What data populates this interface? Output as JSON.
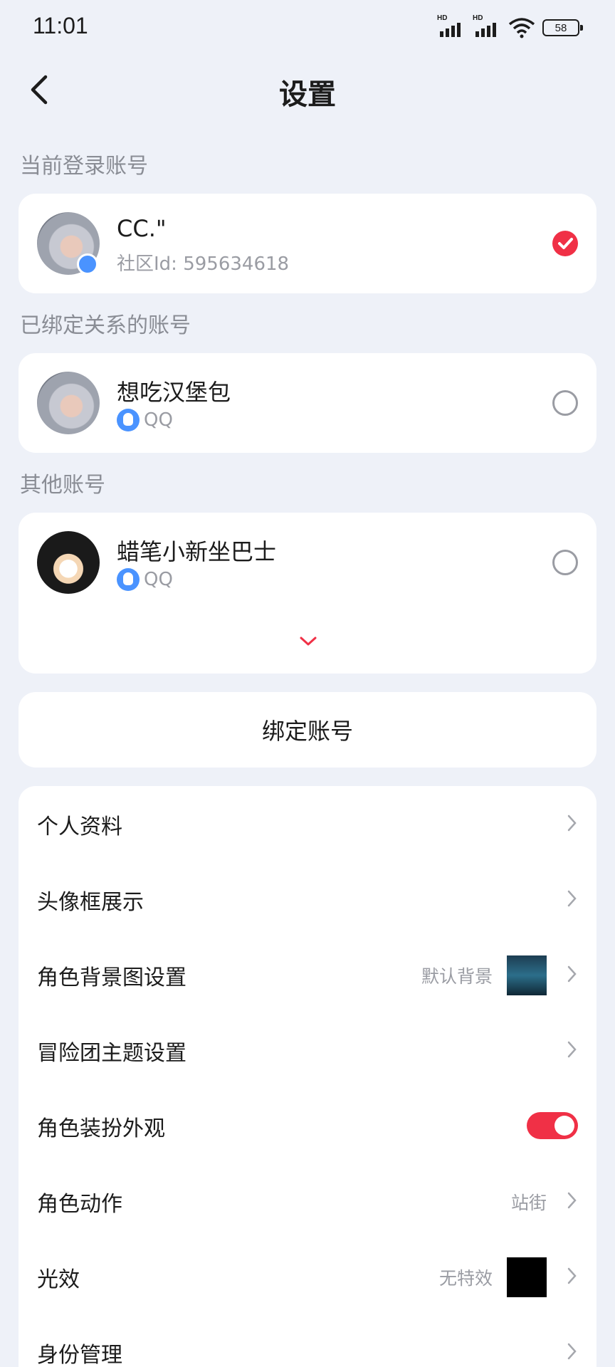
{
  "status_bar": {
    "time": "11:01",
    "hd1": "HD",
    "hd2": "HD",
    "battery": "58"
  },
  "header": {
    "title": "设置"
  },
  "current_account": {
    "section_label": "当前登录账号",
    "name": "CC.\"",
    "community_id": "社区Id: 595634618",
    "selected": true
  },
  "bound_accounts": {
    "section_label": "已绑定关系的账号",
    "items": [
      {
        "name": "想吃汉堡包",
        "platform": "QQ",
        "selected": false
      }
    ]
  },
  "other_accounts": {
    "section_label": "其他账号",
    "items": [
      {
        "name": "蜡笔小新坐巴士",
        "platform": "QQ",
        "selected": false
      }
    ]
  },
  "bind_button": {
    "label": "绑定账号"
  },
  "settings": {
    "items": [
      {
        "label": "个人资料"
      },
      {
        "label": "头像框展示"
      },
      {
        "label": "角色背景图设置",
        "value": "默认背景"
      },
      {
        "label": "冒险团主题设置"
      },
      {
        "label": "角色装扮外观",
        "toggle_on": true
      },
      {
        "label": "角色动作",
        "value": "站街"
      },
      {
        "label": "光效",
        "value": "无特效"
      },
      {
        "label": "身份管理"
      }
    ]
  },
  "colors": {
    "accent": "#f03046",
    "qq": "#4a93ff",
    "background": "#eef1f8"
  }
}
